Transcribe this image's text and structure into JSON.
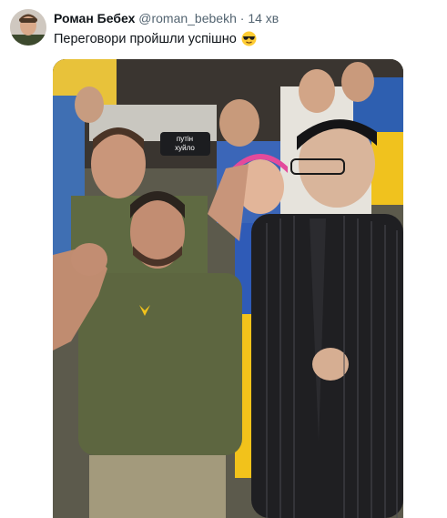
{
  "tweet": {
    "author_name": "Роман Бебех",
    "author_handle": "@roman_bebekh",
    "separator": "·",
    "time": "14 хв",
    "text": "Переговори пройшли успішно",
    "emoji_icon": "smiling-face-with-sunglasses"
  },
  "media": {
    "sign_text_line1": "путін",
    "sign_text_line2": "хуйло"
  },
  "colors": {
    "name": "#0f1419",
    "secondary": "#536471",
    "ukraine_blue": "#2f5bb7",
    "ukraine_yellow": "#f2c21b"
  }
}
